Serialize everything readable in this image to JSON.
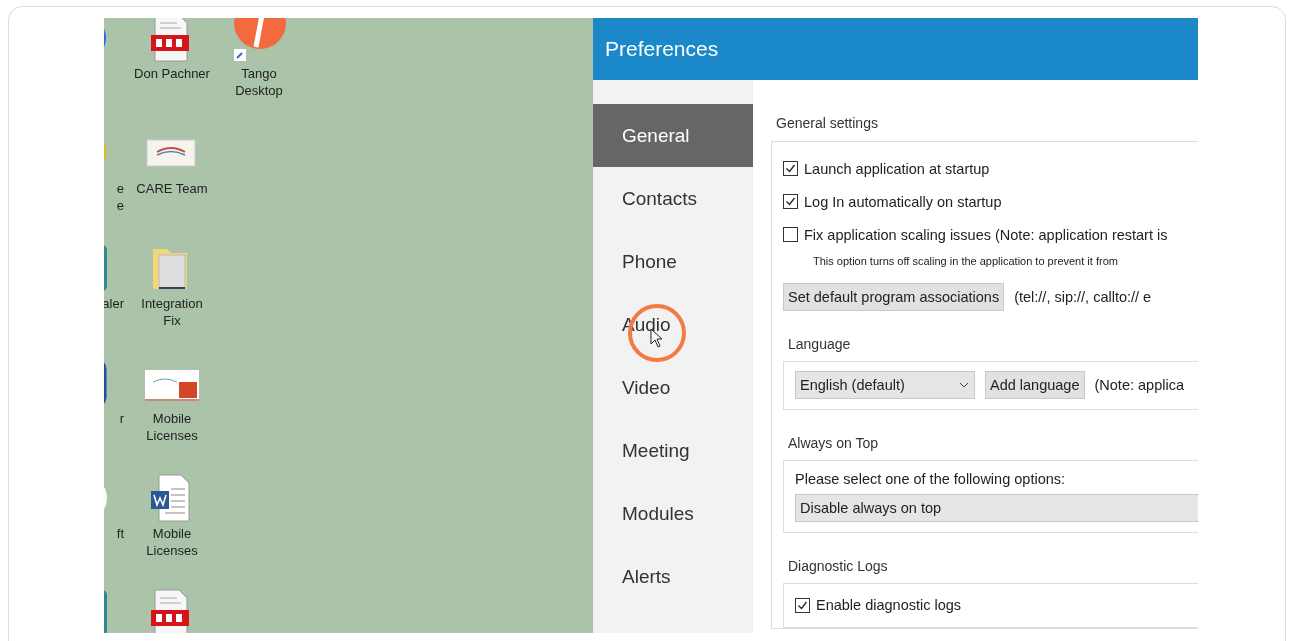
{
  "desktop": {
    "columns": [
      [
        {
          "kind": "blue-circle"
        },
        {
          "kind": "browser",
          "label": "e\ne"
        },
        {
          "kind": "teal-tile",
          "label": "aler"
        },
        {
          "kind": "blue-badge",
          "label": "r"
        },
        {
          "kind": "green-circle",
          "label": "ft"
        },
        {
          "kind": "teal-tile"
        }
      ],
      [
        {
          "kind": "pdf",
          "label": "Don Pachner"
        },
        {
          "kind": "card",
          "label": "CARE Team"
        },
        {
          "kind": "folder",
          "label": "Integration\nFix"
        },
        {
          "kind": "slides",
          "label": "Mobile\nLicenses"
        },
        {
          "kind": "word",
          "label": "Mobile\nLicenses"
        },
        {
          "kind": "pdf"
        }
      ],
      [
        {
          "kind": "tango",
          "label": "Tango\nDesktop"
        }
      ]
    ]
  },
  "preferences": {
    "title": "Preferences",
    "nav": [
      {
        "label": "General",
        "selected": true
      },
      {
        "label": "Contacts",
        "selected": false
      },
      {
        "label": "Phone",
        "selected": false
      },
      {
        "label": "Audio",
        "selected": false
      },
      {
        "label": "Video",
        "selected": false
      },
      {
        "label": "Meeting",
        "selected": false
      },
      {
        "label": "Modules",
        "selected": false
      },
      {
        "label": "Alerts",
        "selected": false
      }
    ],
    "general": {
      "heading": "General settings",
      "options": [
        {
          "label": "Launch application at startup",
          "checked": true
        },
        {
          "label": "Log In automatically on startup",
          "checked": true
        },
        {
          "label": "Fix application scaling issues (Note: application restart is",
          "checked": false,
          "note": "This option turns off scaling in the application to prevent it from"
        }
      ],
      "associations_button": "Set default program associations",
      "associations_hint": "(tel://, sip://, callto:// e"
    },
    "language": {
      "heading": "Language",
      "value": "English (default)",
      "button": "Add language",
      "note": "(Note: applica"
    },
    "always_on_top": {
      "heading": "Always on Top",
      "prompt": "Please select one of the following options:",
      "value": "Disable always on top"
    },
    "diagnostic_logs": {
      "heading": "Diagnostic Logs",
      "options": [
        {
          "label": "Enable diagnostic logs",
          "checked": true
        }
      ]
    }
  }
}
